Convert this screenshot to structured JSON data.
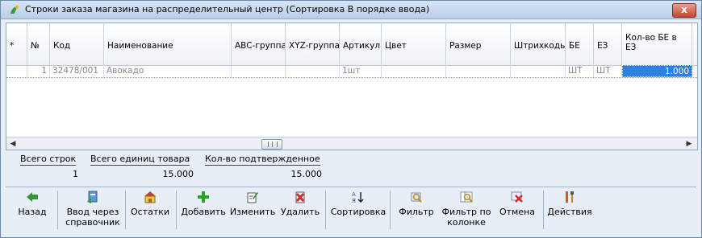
{
  "window": {
    "title": "Строки заказа магазина на распределительный центр (Сортировка В порядке ввода)",
    "close_label": "x"
  },
  "grid": {
    "columns": [
      "*",
      "№",
      "Код",
      "Наименование",
      "ABC-группа",
      "XYZ-группа",
      "Артикул",
      "Цвет",
      "Размер",
      "Штрихкоды",
      "БЕ",
      "ЕЗ",
      "Кол-во БЕ в ЕЗ"
    ],
    "rows": [
      {
        "mark": "",
        "num": "1",
        "code": "32478/001",
        "name": "Авокадо",
        "abc": "",
        "xyz": "",
        "article": "1шт",
        "color": "",
        "size": "",
        "barcodes": "",
        "be": "ШТ",
        "ez": "ШТ",
        "qty": "1.000"
      }
    ]
  },
  "totals": {
    "rows_label": "Всего строк",
    "rows_value": "1",
    "units_label": "Всего единиц товара",
    "units_value": "15.000",
    "confirmed_label": "Кол-во подтвержденное",
    "confirmed_value": "15.000"
  },
  "toolbar": {
    "back": "Назад",
    "lookup": "Ввод через справочник",
    "stock": "Остатки",
    "add": "Добавить",
    "edit": "Изменить",
    "delete": "Удалить",
    "sort": "Сортировка",
    "filter": "Фильтр",
    "filter_col": "Фильтр по колонке",
    "cancel": "Отмена",
    "actions": "Действия"
  },
  "colors": {
    "selection": "#2f7fe8",
    "back_icon": "#2e9b2e",
    "add_icon": "#2aa12a",
    "delete_icon": "#d22b2b"
  }
}
